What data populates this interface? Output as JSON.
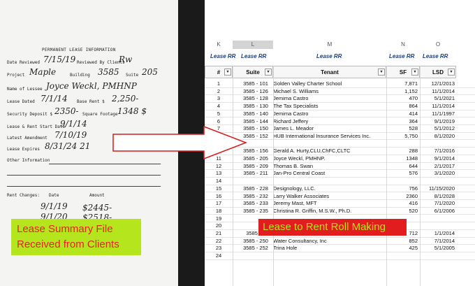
{
  "form": {
    "title": "PERMANENT LEASE INFORMATION",
    "fields": [
      {
        "label": "Date Reviewed",
        "value": "7/15/19"
      },
      {
        "label": "Reviewed By Clients",
        "value": "Rw"
      },
      {
        "label": "Project",
        "value": "Maple"
      },
      {
        "label": "Building",
        "value": "3585"
      },
      {
        "label": "Suite",
        "value": "205"
      },
      {
        "label": "Name of Lessee",
        "value": "Joyce Weckl, PMHNP"
      },
      {
        "label": "Lease Dated",
        "value": "7/1/14"
      },
      {
        "label": "Base Rent $",
        "value": "2,250-"
      },
      {
        "label": "Security Deposit $",
        "value": "2350-"
      },
      {
        "label": "Square Footage",
        "value": "1348 $"
      },
      {
        "label": "Lease & Rent Start Date",
        "value": "9/1/14"
      },
      {
        "label": "Latest Amendment",
        "value": "7/10/19"
      },
      {
        "label": "Lease Expires",
        "value": "8/31/24 21"
      },
      {
        "label": "Other Information",
        "value": ""
      }
    ],
    "rent_changes_label": "Rent Changes:",
    "date_label": "Date",
    "amount_label": "Amount",
    "rent_changes": [
      {
        "date": "9/1/19",
        "amount": "$2445-"
      },
      {
        "date": "9/1/20",
        "amount": "$2518-"
      }
    ]
  },
  "badges": {
    "left_line1": "Lease Summary File",
    "left_line2": "Received from Clients",
    "right": "Lease to Rent Roll Making"
  },
  "sheet": {
    "columns": [
      "K",
      "L",
      "M",
      "N",
      "O"
    ],
    "group_label": "Lease RR",
    "headers": {
      "num": "#",
      "suite": "Suite",
      "tenant": "Tenant",
      "sf": "SF",
      "lsd": "LSD"
    },
    "rows": [
      {
        "n": "1",
        "suite": "3585 - 101",
        "tenant": "Golden Valley Charter School",
        "sf": "7,871",
        "lsd": "12/1/2013"
      },
      {
        "n": "2",
        "suite": "3585 - 126",
        "tenant": "Michael S. Williams",
        "sf": "1,152",
        "lsd": "11/1/2014"
      },
      {
        "n": "3",
        "suite": "3585 - 128",
        "tenant": "Jemima Castro",
        "sf": "470",
        "lsd": "5/1/2021"
      },
      {
        "n": "4",
        "suite": "3585 - 130",
        "tenant": "The Tax Specialists",
        "sf": "864",
        "lsd": "11/1/2014"
      },
      {
        "n": "5",
        "suite": "3585 - 140",
        "tenant": "Jemima Castro",
        "sf": "414",
        "lsd": "11/1/1997"
      },
      {
        "n": "6",
        "suite": "3585 - 144",
        "tenant": "Richard Jeffery",
        "sf": "364",
        "lsd": "9/1/2019"
      },
      {
        "n": "7",
        "suite": "3585 - 150",
        "tenant": "James L. Meador",
        "sf": "528",
        "lsd": "5/1/2012"
      },
      {
        "n": "8",
        "suite": "3585 - 152",
        "tenant": "HUB International Insurance Services Inc.",
        "sf": "5,750",
        "lsd": "8/1/2020"
      },
      {
        "n": "9",
        "suite": "",
        "tenant": "",
        "sf": "",
        "lsd": ""
      },
      {
        "n": "10",
        "suite": "3585 - 156",
        "tenant": "Gerald A. Hurty,CLU,ChFC,CLTC",
        "sf": "288",
        "lsd": "7/1/2016"
      },
      {
        "n": "11",
        "suite": "3585 - 205",
        "tenant": "Joyce Weckl, PMHNP.",
        "sf": "1348",
        "lsd": "9/1/2014"
      },
      {
        "n": "12",
        "suite": "3585 - 209",
        "tenant": "Thomas B. Swan",
        "sf": "644",
        "lsd": "2/1/2017"
      },
      {
        "n": "13",
        "suite": "3585 - 211",
        "tenant": "Jan-Pro Central Coast",
        "sf": "576",
        "lsd": "3/1/2020"
      },
      {
        "n": "14",
        "suite": "",
        "tenant": "",
        "sf": "",
        "lsd": ""
      },
      {
        "n": "15",
        "suite": "3585 - 228",
        "tenant": "Designology, LLC.",
        "sf": "756",
        "lsd": "11/15/2020"
      },
      {
        "n": "16",
        "suite": "3585 - 232",
        "tenant": "Larry Walker Associates",
        "sf": "2360",
        "lsd": "8/1/2028"
      },
      {
        "n": "17",
        "suite": "3585 - 233",
        "tenant": "Jeremy Mast, MFT",
        "sf": "416",
        "lsd": "7/1/2020"
      },
      {
        "n": "18",
        "suite": "3585 - 235",
        "tenant": "Christina R. Griffin, M.S.W., Ph.D.",
        "sf": "520",
        "lsd": "6/1/2006"
      },
      {
        "n": "19",
        "suite": "",
        "tenant": "",
        "sf": "",
        "lsd": ""
      },
      {
        "n": "20",
        "suite": "",
        "tenant": "",
        "sf": "",
        "lsd": ""
      },
      {
        "n": "21",
        "suite": "3585 - 2",
        "tenant": "",
        "sf": "712",
        "lsd": "1/1/2014"
      },
      {
        "n": "22",
        "suite": "3585 - 250",
        "tenant": "Water Consultancy, Inc",
        "sf": "852",
        "lsd": "7/1/2014"
      },
      {
        "n": "23",
        "suite": "3585 - 252",
        "tenant": "Trina Hole",
        "sf": "425",
        "lsd": "5/1/2005"
      },
      {
        "n": "24",
        "suite": "",
        "tenant": "",
        "sf": "",
        "lsd": ""
      }
    ]
  },
  "colors": {
    "green": "#b5e61d",
    "red": "#e11d1d",
    "header_blue": "#1f3f7a"
  }
}
